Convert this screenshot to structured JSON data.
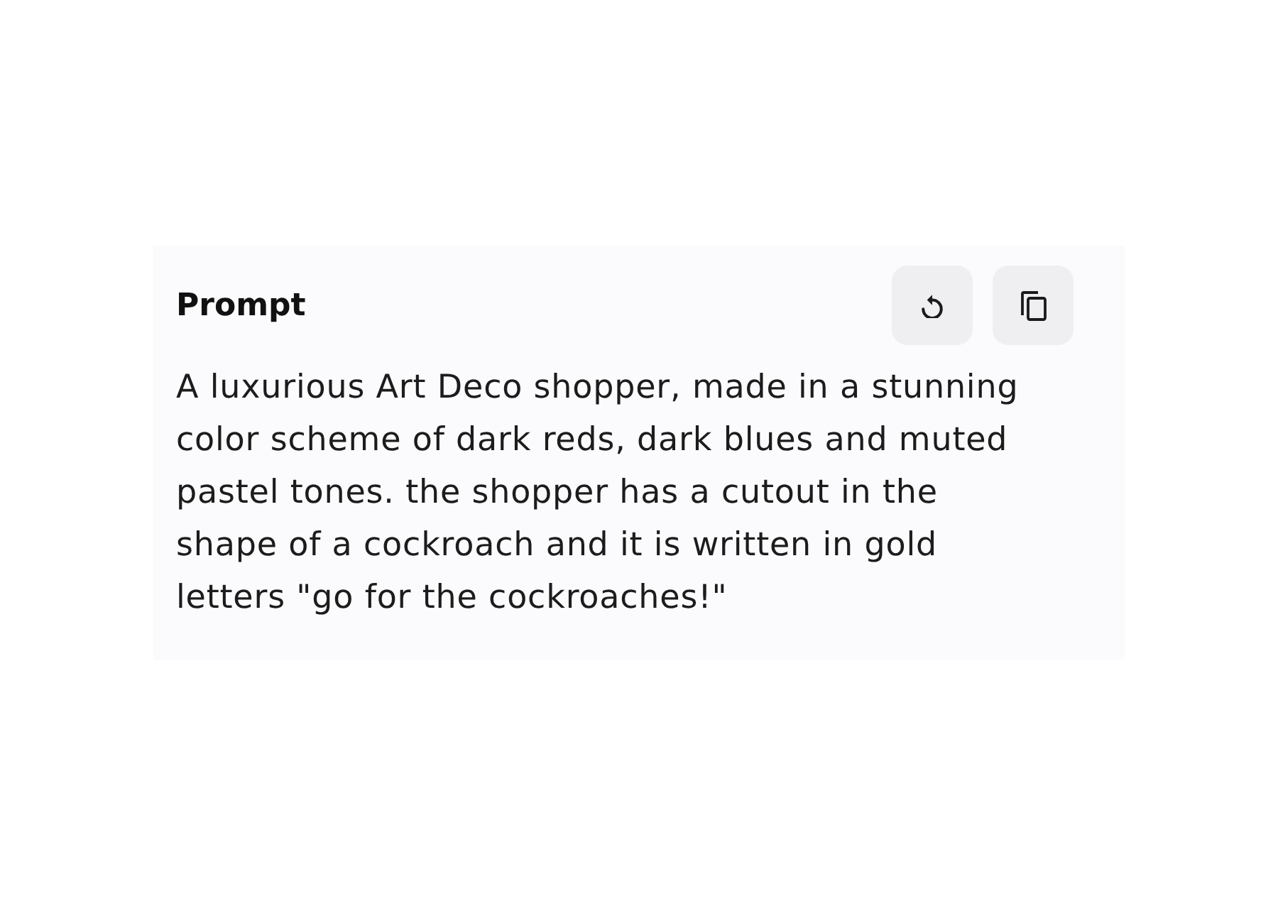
{
  "prompt_panel": {
    "title": "Prompt",
    "actions": [
      {
        "kind": "regenerate"
      },
      {
        "kind": "copy"
      }
    ],
    "text": "A luxurious Art Deco shopper, made in a stunning color scheme of dark reds, dark blues and muted pastel tones. the shopper has a cutout in the shape of a cockroach and it is written in gold letters \"go for the cockroaches!\""
  }
}
